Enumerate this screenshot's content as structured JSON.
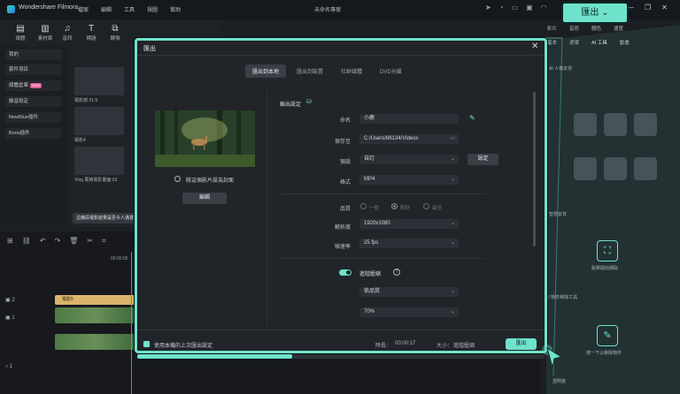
{
  "app": {
    "name": "Wondershare Filmora",
    "project_title": "未命名專案",
    "menu": [
      "檔案",
      "編輯",
      "工具",
      "視圖",
      "幫助"
    ]
  },
  "toolbar": {
    "items": [
      {
        "label": "媒體",
        "icon": "media-icon"
      },
      {
        "label": "素材庫",
        "icon": "stock-icon"
      },
      {
        "label": "音訊",
        "icon": "audio-icon"
      },
      {
        "label": "標題",
        "icon": "title-icon"
      },
      {
        "label": "轉場",
        "icon": "transition-icon"
      }
    ]
  },
  "sidebar": {
    "items": [
      {
        "label": "我的"
      },
      {
        "label": "套件項目"
      },
      {
        "label": "媒體倉庫",
        "badge": "NEW"
      },
      {
        "label": "錄音設定"
      },
      {
        "label": "NewBlue插件"
      },
      {
        "label": "Boris插件"
      }
    ]
  },
  "thumbs": {
    "items": [
      "電影感 21:9",
      "電影4",
      "Vlog 風格電影畫面:03"
    ],
    "tip": "這幾段電影結果是否令人滿意"
  },
  "timeline": {
    "time": "00:00:05",
    "clip_label": "電影5"
  },
  "right_panel": {
    "tabs": [
      "影片",
      "音訊",
      "顏色",
      "速度"
    ],
    "subtabs": [
      "基本",
      "遮罩",
      "AI 工具",
      "動畫"
    ],
    "section1": "AI 人像去背",
    "section2": "智慧去背",
    "section3": "AI 物件移除工具",
    "smart_label": "點擊開始擷取",
    "remove_label": "按一下以移除物件",
    "bottom_label": "透明度"
  },
  "dialog": {
    "title": "匯出",
    "tabs": [
      "匯出到本地",
      "匯出到裝置",
      "社群媒體",
      "DVD光碟"
    ],
    "active_tab": 0,
    "settings_heading": "輸出設定",
    "rows": [
      {
        "label": "命名",
        "value": "小鹿"
      },
      {
        "label": "保存至",
        "value": "C:/Users/86134/Videos"
      },
      {
        "label": "預設",
        "value": "自訂"
      },
      {
        "label": "格式",
        "value": "MP4"
      },
      {
        "label": "品質",
        "value": ""
      },
      {
        "label": "解析度",
        "value": "1920x1080"
      },
      {
        "label": "幀速率",
        "value": "25 fps"
      }
    ],
    "preset_button": "設定",
    "quality_options": [
      "一般",
      "較好",
      "最佳"
    ],
    "advanced_label": "進階壓縮",
    "advanced_select1": "依品質",
    "advanced_select2": "70%",
    "snapshot_option": "將這個影片設為封面",
    "edit_button": "編輯",
    "remember_label": "使用本機的上次匯出設定",
    "duration_label": "時長：",
    "duration_value": "00:00:17",
    "size_label": "大小：",
    "size_value": "進階壓縮",
    "export_button": "匯出"
  },
  "callout": {
    "label": "匯出"
  },
  "colors": {
    "accent": "#6fe2cb",
    "dialog_bg": "#212429",
    "app_bg": "#1c1f24"
  },
  "export_progress": 0.38
}
